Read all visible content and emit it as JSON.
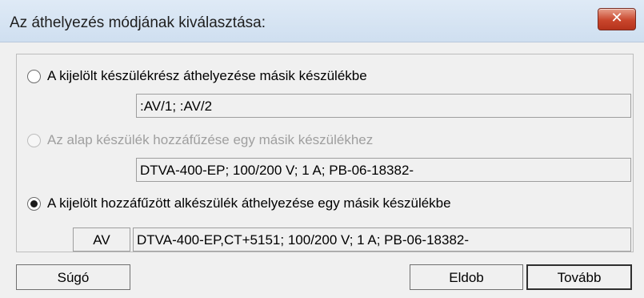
{
  "window": {
    "title": "Az áthelyezés módjának kiválasztása:",
    "close_label": "✕"
  },
  "options": [
    {
      "label": "A kijelölt készülékrész áthelyezése másik készülékbe",
      "selected": false,
      "enabled": true,
      "field_value": ":AV/1; :AV/2"
    },
    {
      "label": "Az alap készülék hozzáfűzése egy másik készülékhez",
      "selected": false,
      "enabled": false,
      "field_value": "DTVA-400-EP; 100/200 V; 1 A; PB-06-18382-"
    },
    {
      "label": "A kijelölt hozzáfűzött alkészülék áthelyezése egy másik készülékbe",
      "selected": true,
      "enabled": true,
      "field_prefix": "AV",
      "field_value": "DTVA-400-EP,CT+5151; 100/200 V; 1 A; PB-06-18382-"
    }
  ],
  "buttons": {
    "help": "Súgó",
    "discard": "Eldob",
    "next": "Tovább"
  }
}
